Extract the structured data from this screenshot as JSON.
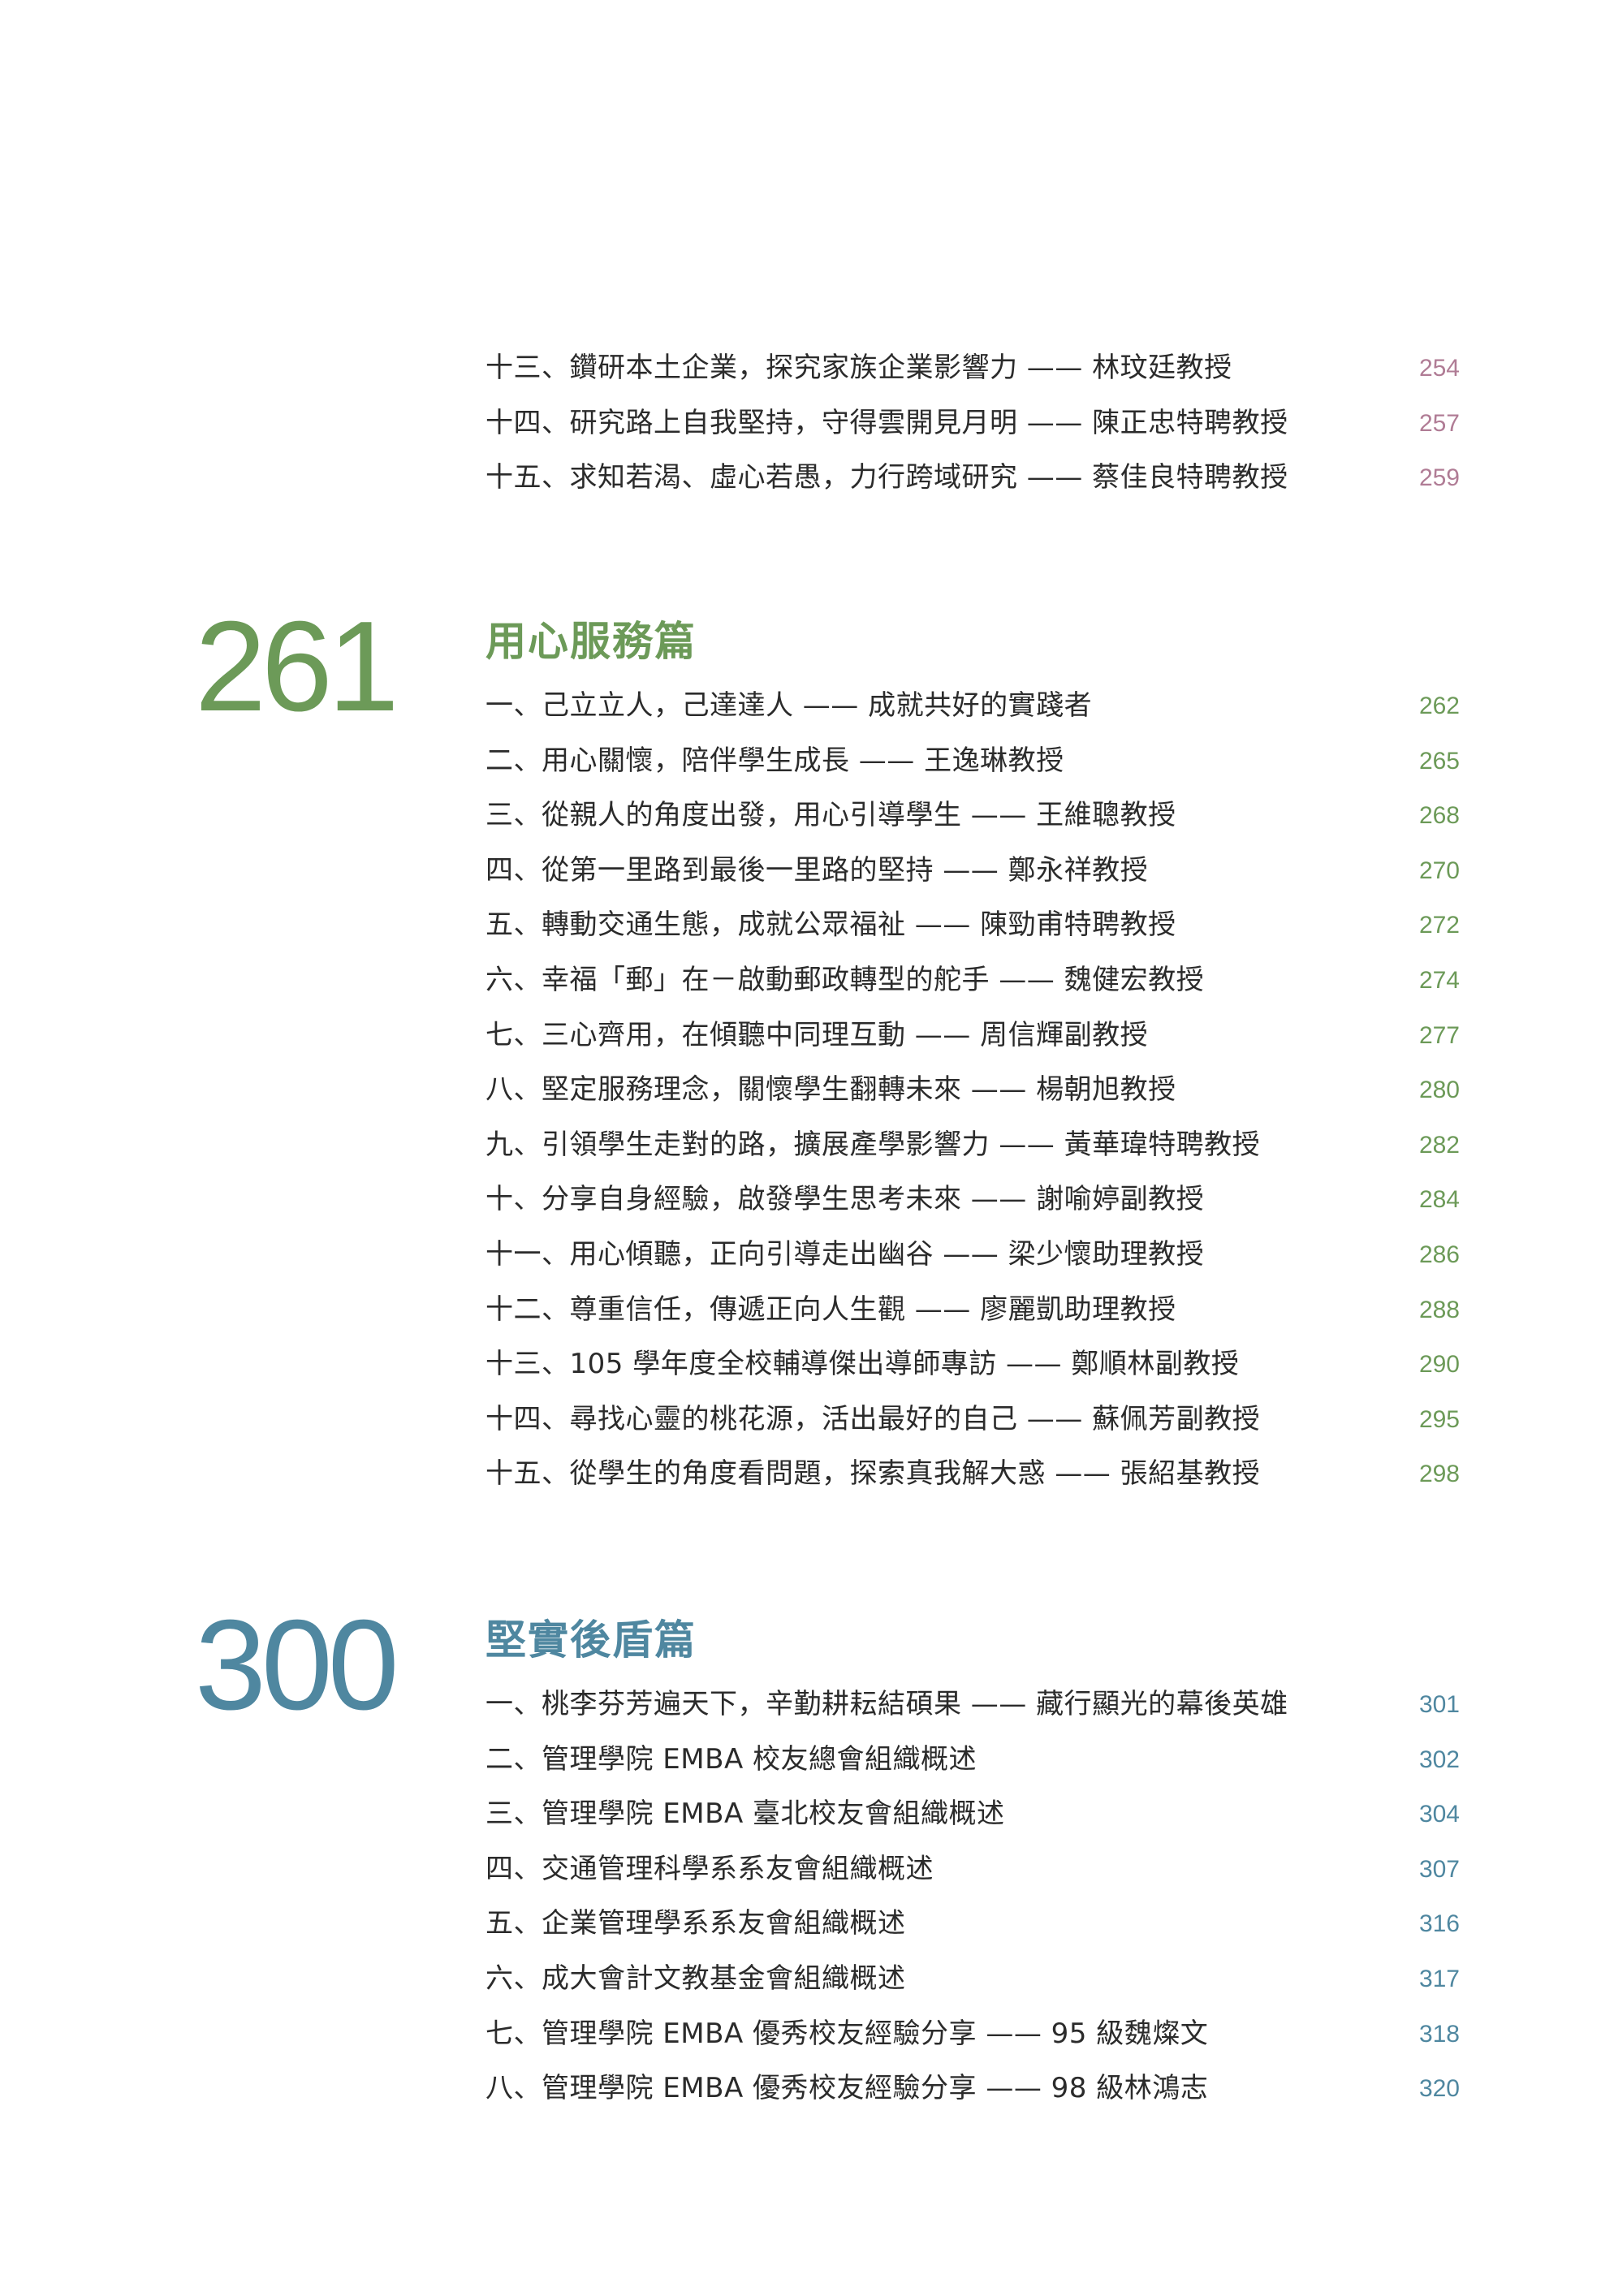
{
  "research": {
    "entries": [
      {
        "title": "十三、鑽研本土企業，探究家族企業影響力 —— 林玟廷教授",
        "page": "254"
      },
      {
        "title": "十四、研究路上自我堅持，守得雲開見月明 —— 陳正忠特聘教授",
        "page": "257"
      },
      {
        "title": "十五、求知若渴、虛心若愚，力行跨域研究 —— 蔡佳良特聘教授",
        "page": "259"
      }
    ]
  },
  "service": {
    "number": "261",
    "title": "用心服務篇",
    "entries": [
      {
        "title": "一、己立立人，己達達人 —— 成就共好的實踐者",
        "page": "262"
      },
      {
        "title": "二、用心關懷，陪伴學生成長 —— 王逸琳教授",
        "page": "265"
      },
      {
        "title": "三、從親人的角度出發，用心引導學生 —— 王維聰教授",
        "page": "268"
      },
      {
        "title": "四、從第一里路到最後一里路的堅持 —— 鄭永祥教授",
        "page": "270"
      },
      {
        "title": "五、轉動交通生態，成就公眾福祉 —— 陳勁甫特聘教授",
        "page": "272"
      },
      {
        "title": "六、幸福「郵」在－啟動郵政轉型的舵手 —— 魏健宏教授",
        "page": "274"
      },
      {
        "title": "七、三心齊用，在傾聽中同理互動 —— 周信輝副教授",
        "page": "277"
      },
      {
        "title": "八、堅定服務理念，關懷學生翻轉未來 —— 楊朝旭教授",
        "page": "280"
      },
      {
        "title": "九、引領學生走對的路，擴展產學影響力 —— 黃華瑋特聘教授",
        "page": "282"
      },
      {
        "title": "十、分享自身經驗，啟發學生思考未來 —— 謝喻婷副教授",
        "page": "284"
      },
      {
        "title": "十一、用心傾聽，正向引導走出幽谷 —— 梁少懷助理教授",
        "page": "286"
      },
      {
        "title": "十二、尊重信任，傳遞正向人生觀 —— 廖麗凱助理教授",
        "page": "288"
      },
      {
        "title": "十三、105 學年度全校輔導傑出導師專訪 —— 鄭順林副教授",
        "page": "290"
      },
      {
        "title": "十四、尋找心靈的桃花源，活出最好的自己 —— 蘇佩芳副教授",
        "page": "295"
      },
      {
        "title": "十五、從學生的角度看問題，探索真我解大惑 —— 張紹基教授",
        "page": "298"
      }
    ]
  },
  "support": {
    "number": "300",
    "title": "堅實後盾篇",
    "entries": [
      {
        "title": "一、桃李芬芳遍天下，辛勤耕耘結碩果 —— 藏行顯光的幕後英雄",
        "page": "301"
      },
      {
        "title": "二、管理學院 EMBA 校友總會組織概述",
        "page": "302"
      },
      {
        "title": "三、管理學院 EMBA 臺北校友會組織概述",
        "page": "304"
      },
      {
        "title": "四、交通管理科學系系友會組織概述",
        "page": "307"
      },
      {
        "title": "五、企業管理學系系友會組織概述",
        "page": "316"
      },
      {
        "title": "六、成大會計文教基金會組織概述",
        "page": "317"
      },
      {
        "title": "七、管理學院 EMBA 優秀校友經驗分享 —— 95 級魏燦文",
        "page": "318"
      },
      {
        "title": "八、管理學院 EMBA 優秀校友經驗分享 —— 98 級林鴻志",
        "page": "320"
      }
    ]
  }
}
